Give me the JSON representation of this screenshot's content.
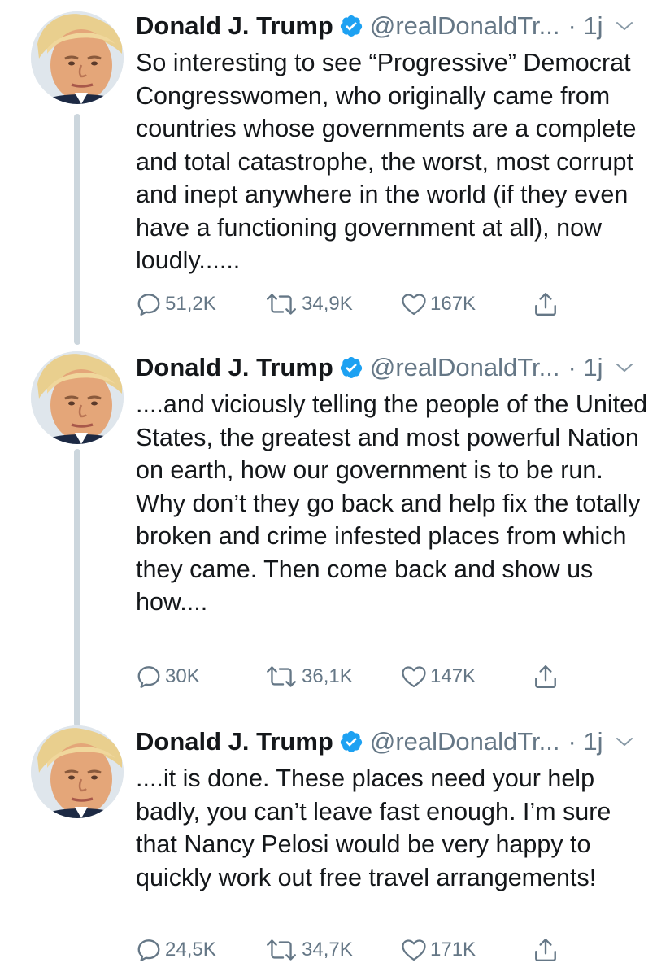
{
  "tweets": [
    {
      "name": "Donald J. Trump",
      "handle": "@realDonaldTr...",
      "time": "· 1j",
      "text": "So interesting to see “Progressive” Democrat Congresswomen, who originally came from countries whose governments are a complete and total catastrophe, the worst, most corrupt and inept anywhere in the world (if they even have a functioning government at all), now loudly......",
      "replies": "51,2K",
      "retweets": "34,9K",
      "likes": "167K"
    },
    {
      "name": "Donald J. Trump",
      "handle": "@realDonaldTr...",
      "time": "· 1j",
      "text": "....and viciously telling the people of the United States, the greatest and most powerful Nation on earth, how our government is to be run. Why don’t they go back and help fix the totally broken and crime infested places from which they came. Then come back and show us how....",
      "replies": "30K",
      "retweets": "36,1K",
      "likes": "147K"
    },
    {
      "name": "Donald J. Trump",
      "handle": "@realDonaldTr...",
      "time": "· 1j",
      "text": "....it is done. These places need your help badly, you can’t leave fast enough. I’m sure that Nancy Pelosi would be very happy to quickly work out free travel arrangements!",
      "replies": "24,5K",
      "retweets": "34,7K",
      "likes": "171K"
    }
  ],
  "colors": {
    "verified": "#1da1f2",
    "muted": "#657786",
    "thread_line": "#ccd6dd",
    "text": "#14171a"
  },
  "icons": [
    "verified-badge-icon",
    "chevron-down-icon",
    "reply-icon",
    "retweet-icon",
    "like-icon",
    "share-icon"
  ]
}
